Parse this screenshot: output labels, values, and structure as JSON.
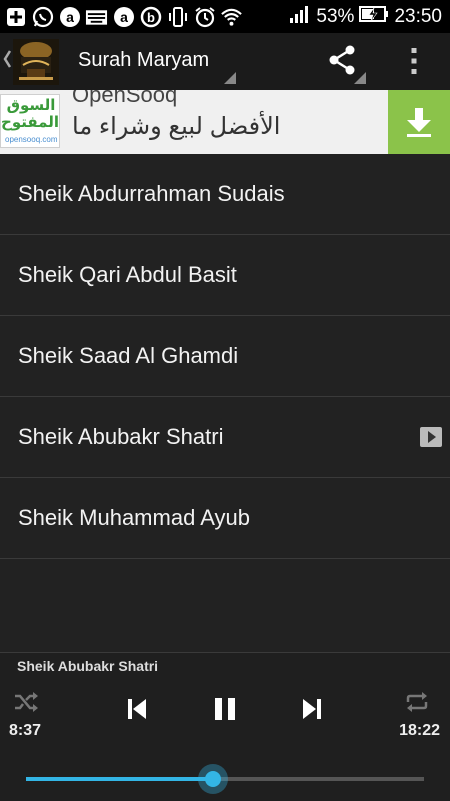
{
  "status_bar": {
    "left_icons": [
      "add-icon",
      "whatsapp-icon",
      "circle-a-icon",
      "keyboard-icon",
      "circle-a-icon",
      "beats-icon",
      "vibrate-icon",
      "alarm-icon",
      "wifi-icon"
    ],
    "battery_percent": "53%",
    "time": "23:50"
  },
  "action_bar": {
    "title": "Surah Maryam"
  },
  "ad": {
    "advertiser": "OpenSooq",
    "logo_arabic": "السوق المفتوح",
    "logo_brand": "opensooq.com",
    "text_arabic": "الأفضل لبيع وشراء ما"
  },
  "reciters": [
    {
      "label": "Sheik Abdurrahman Sudais",
      "playing": false
    },
    {
      "label": "Sheik Qari Abdul Basit",
      "playing": false
    },
    {
      "label": "Sheik Saad Al Ghamdi",
      "playing": false
    },
    {
      "label": "Sheik Abubakr Shatri",
      "playing": true
    },
    {
      "label": "Sheik Muhammad Ayub",
      "playing": false
    }
  ],
  "player": {
    "now_playing": "Sheik Abubakr Shatri",
    "elapsed": "8:37",
    "duration": "18:22",
    "progress": 0.47
  },
  "colors": {
    "accent": "#33b5e5",
    "download_green": "#8bc34a",
    "background": "#222222"
  }
}
